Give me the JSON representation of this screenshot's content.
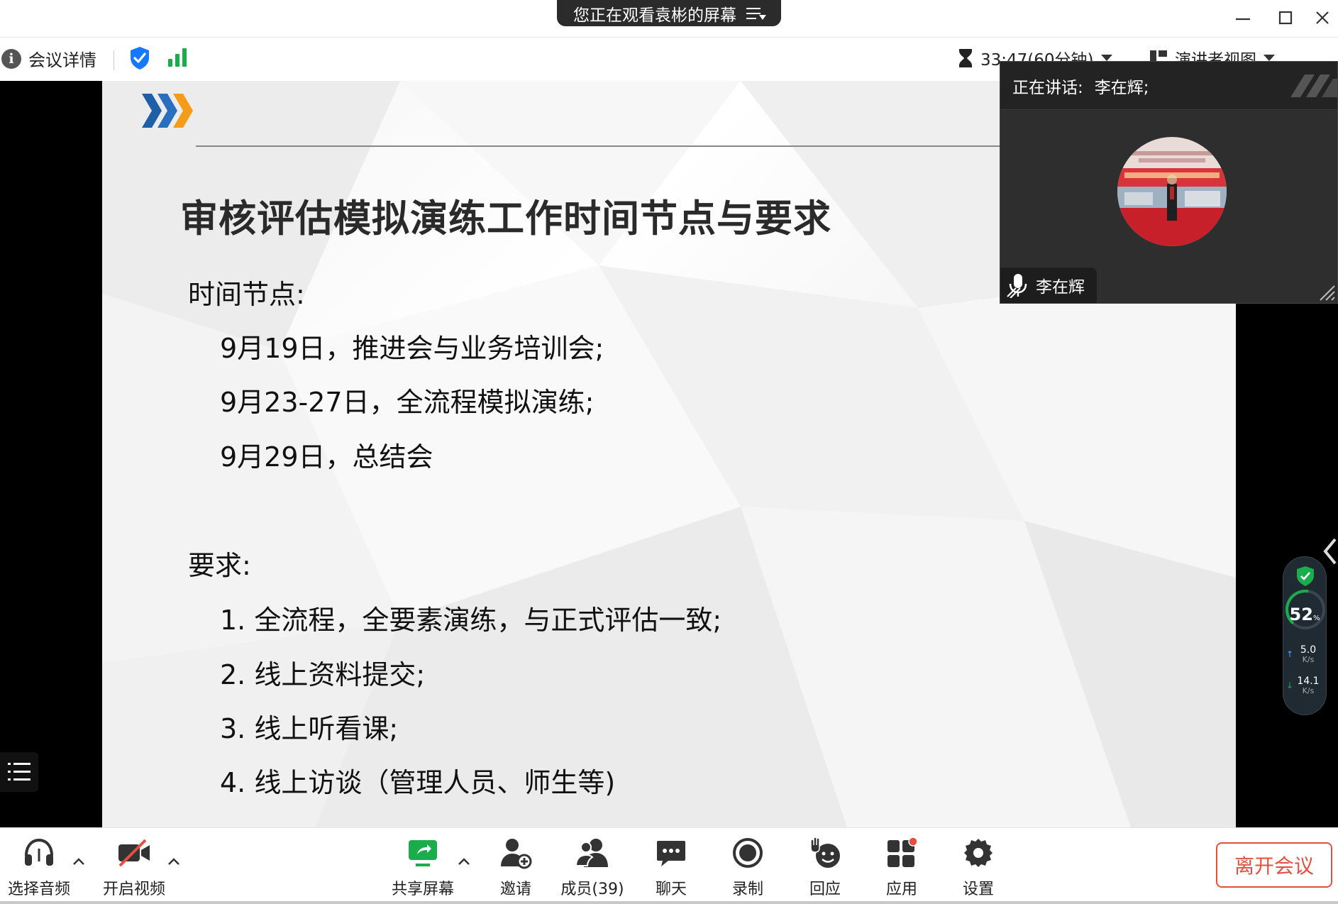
{
  "titlebar": {
    "share_notice": "您正在观看袁彬的屏幕"
  },
  "infobar": {
    "meeting_details": "会议详情",
    "timer": "33:47(60分钟)",
    "view_mode": "演讲者视图"
  },
  "slide": {
    "title": "审核评估模拟演练工作时间节点与要求",
    "time_heading": "时间节点:",
    "time_items": [
      "9月19日，推进会与业务培训会;",
      "9月23-27日，全流程模拟演练;",
      "9月29日，总结会"
    ],
    "req_heading": "要求:",
    "req_items": [
      "1. 全流程，全要素演练，与正式评估一致;",
      "2. 线上资料提交;",
      "3. 线上听看课;",
      "4. 线上访谈（管理人员、师生等)"
    ]
  },
  "speaker": {
    "label": "正在讲话:",
    "name": "李在辉;",
    "tag_name": "李在辉"
  },
  "network": {
    "percent": "52",
    "percent_unit": "%",
    "upload": "5.0",
    "download": "14.1",
    "unit": "K/s",
    "usage_fraction": 0.52
  },
  "toolbar": {
    "audio": "选择音频",
    "video": "开启视频",
    "share": "共享屏幕",
    "invite": "邀请",
    "members": "成员(39)",
    "chat": "聊天",
    "record": "录制",
    "react": "回应",
    "apps": "应用",
    "settings": "设置",
    "leave": "离开会议"
  },
  "colors": {
    "accent_green": "#1aad4b",
    "shield_blue": "#1677ff",
    "leave_red": "#e2513f",
    "logo_blue": "#1f5fa8",
    "logo_orange": "#f39c1a"
  }
}
